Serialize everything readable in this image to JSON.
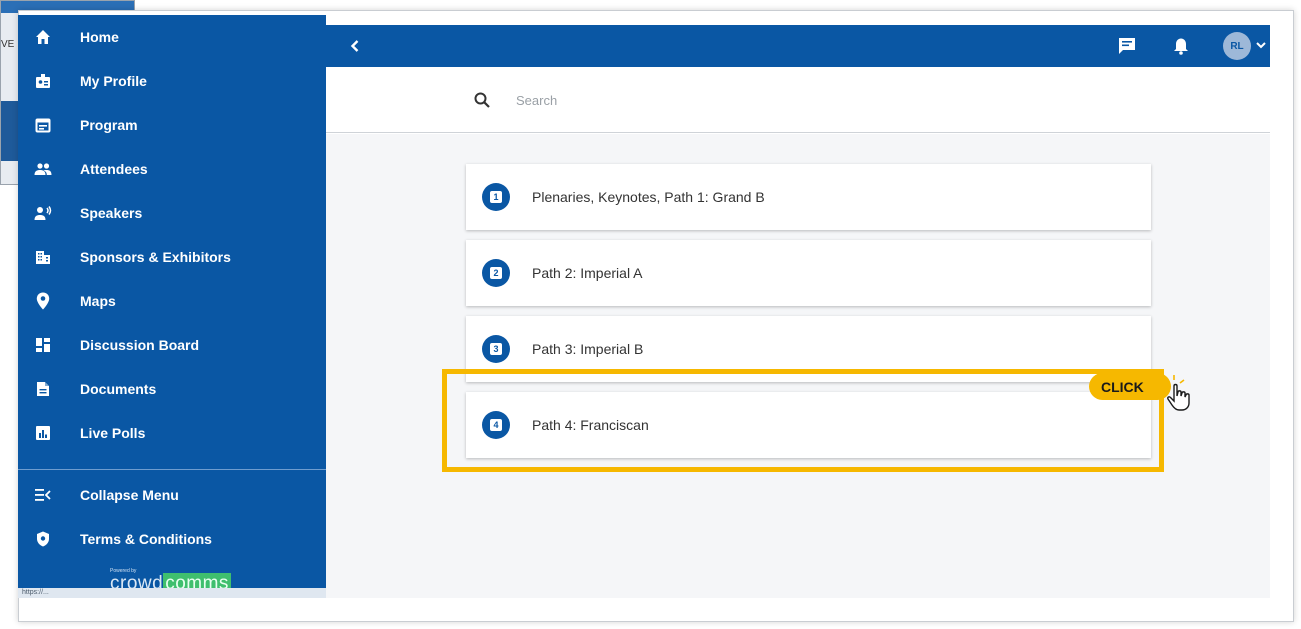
{
  "background_window": {
    "text_fragment": "VE"
  },
  "sidebar": {
    "items": [
      {
        "label": "Home",
        "icon": "home-icon"
      },
      {
        "label": "My Profile",
        "icon": "profile-badge-icon"
      },
      {
        "label": "Program",
        "icon": "calendar-icon"
      },
      {
        "label": "Attendees",
        "icon": "people-icon"
      },
      {
        "label": "Speakers",
        "icon": "speaker-icon"
      },
      {
        "label": "Sponsors & Exhibitors",
        "icon": "building-icon"
      },
      {
        "label": "Maps",
        "icon": "map-pin-icon"
      },
      {
        "label": "Discussion Board",
        "icon": "dashboard-icon"
      },
      {
        "label": "Documents",
        "icon": "document-icon"
      },
      {
        "label": "Live Polls",
        "icon": "poll-icon"
      }
    ],
    "footer_items": [
      {
        "label": "Collapse Menu",
        "icon": "collapse-menu-icon"
      },
      {
        "label": "Terms & Conditions",
        "icon": "shield-icon"
      }
    ],
    "powered_by": "Powered by",
    "brand_part1": "crowd",
    "brand_part2": "comms"
  },
  "status_bar": {
    "url": "https://..."
  },
  "topbar": {
    "avatar_initials": "RL"
  },
  "search": {
    "placeholder": "Search",
    "value": ""
  },
  "cards": [
    {
      "number": "1",
      "title": "Plenaries, Keynotes, Path 1: Grand B"
    },
    {
      "number": "2",
      "title": "Path 2: Imperial A"
    },
    {
      "number": "3",
      "title": "Path 3: Imperial B"
    },
    {
      "number": "4",
      "title": "Path 4: Franciscan"
    }
  ],
  "callout": {
    "label": "CLICK"
  },
  "colors": {
    "brand_blue": "#0a57a4",
    "highlight_yellow": "#f6b800",
    "content_bg": "#f5f6f8"
  }
}
